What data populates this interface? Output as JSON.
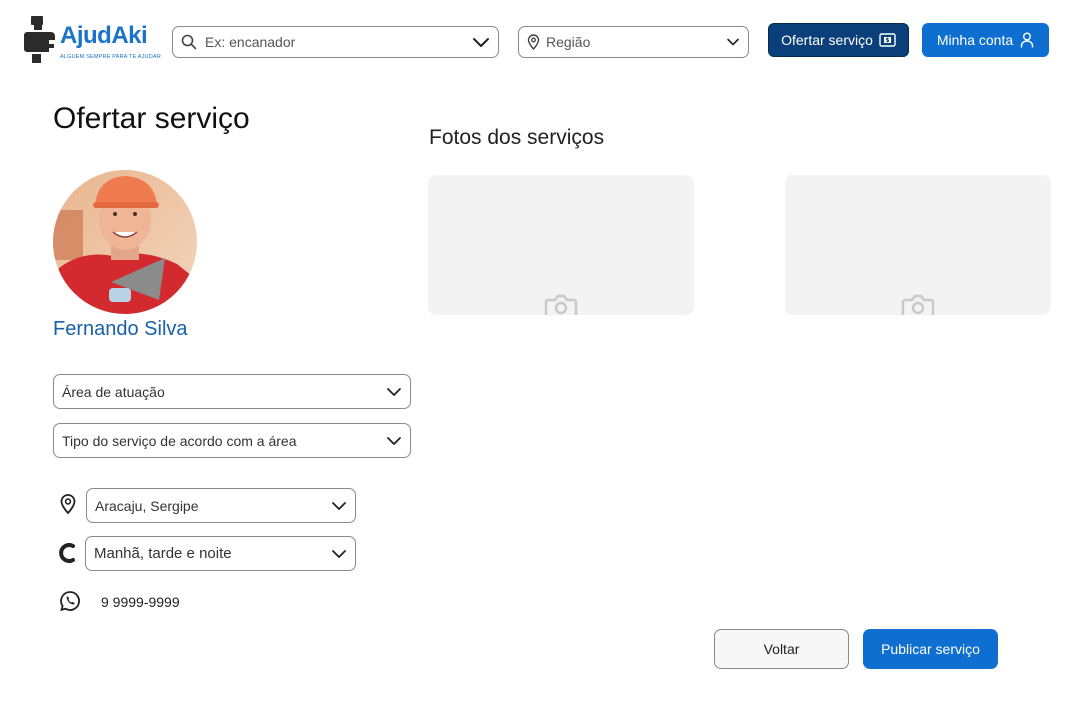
{
  "brand": {
    "name": "AjudAki",
    "tagline": "ALGUEM SEMPRE PARA TE AJUDAR",
    "color": "#1a73c7"
  },
  "header": {
    "search": {
      "placeholder": "Ex: encanador",
      "icon": "search-icon"
    },
    "region": {
      "placeholder": "Região",
      "icon": "location-pin-icon"
    },
    "offer_button": {
      "label": "Ofertar serviço",
      "icon": "money-icon",
      "color": "#0b3f7a"
    },
    "account_button": {
      "label": "Minha conta",
      "icon": "user-icon",
      "color": "#0f6fd1"
    }
  },
  "profile": {
    "page_title": "Ofertar serviço",
    "name": "Fernando Silva",
    "area_select": "Área de atuação",
    "type_select": "Tipo do serviço de acordo com a área",
    "location": "Aracaju, Sergipe",
    "availability": "Manhã, tarde e noite",
    "phone": "9 9999-9999"
  },
  "photos": {
    "title": "Fotos dos serviços",
    "slots": [
      "photo-slot-1",
      "photo-slot-2"
    ]
  },
  "actions": {
    "back_label": "Voltar",
    "publish_label": "Publicar serviço"
  }
}
